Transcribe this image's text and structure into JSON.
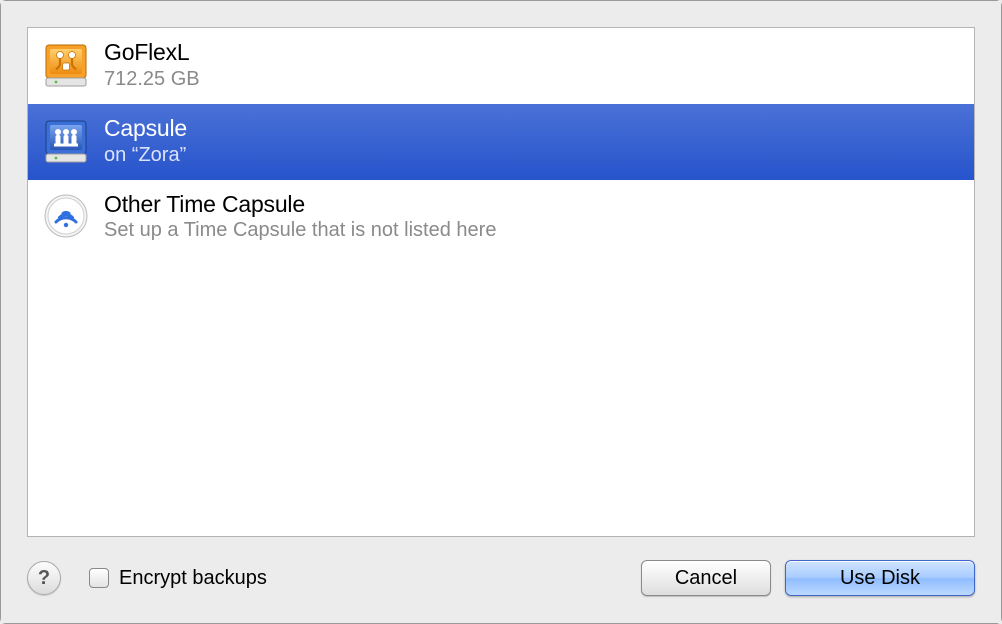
{
  "disks": [
    {
      "title": "GoFlexL",
      "subtitle": "712.25 GB",
      "icon": "usb-drive-icon",
      "selected": false
    },
    {
      "title": "Capsule",
      "subtitle": "on “Zora”",
      "icon": "network-drive-icon",
      "selected": true
    },
    {
      "title": "Other Time Capsule",
      "subtitle": "Set up a Time Capsule that is not listed here",
      "icon": "airport-icon",
      "selected": false
    }
  ],
  "footer": {
    "help_label": "?",
    "encrypt_label": "Encrypt backups",
    "encrypt_checked": false,
    "cancel_label": "Cancel",
    "confirm_label": "Use Disk"
  }
}
